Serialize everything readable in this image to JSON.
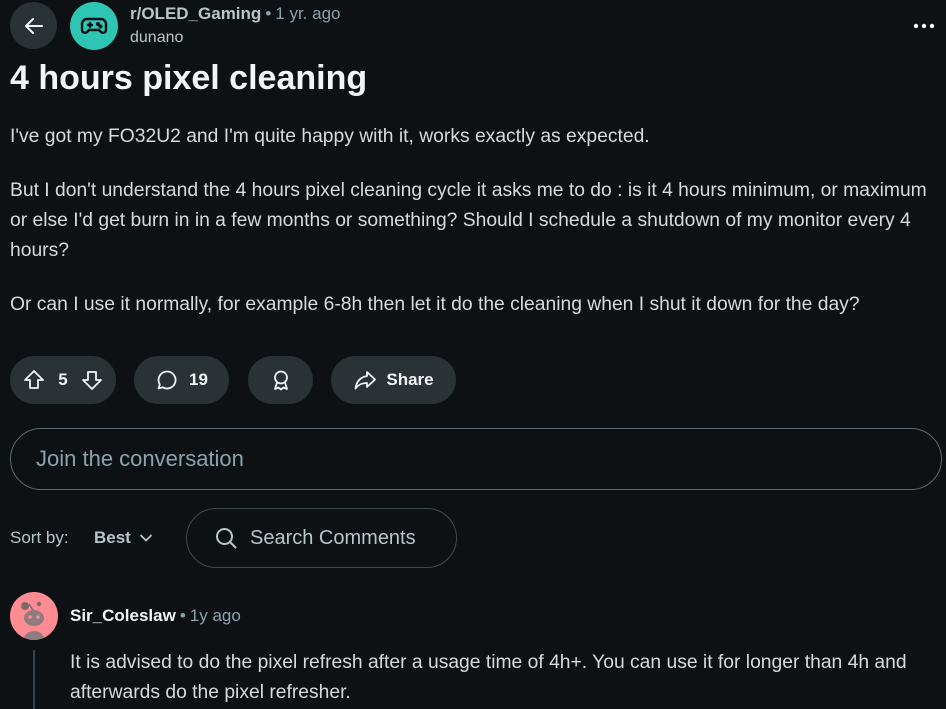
{
  "header": {
    "back_icon": "arrow-left-icon",
    "subreddit": "r/OLED_Gaming",
    "separator": "•",
    "age": "1 yr. ago",
    "author": "dunano",
    "subreddit_icon": "gamepad-icon",
    "subreddit_color": "#2ec5b4",
    "more_icon": "more-horizontal-icon"
  },
  "post": {
    "title": "4 hours pixel cleaning",
    "paragraphs": [
      "I've got my FO32U2 and I'm quite happy with it, works exactly as expected.",
      "But I don't understand the 4 hours pixel cleaning cycle it asks me to do : is it 4 hours minimum, or maximum or else I'd get burn in in a few months or something? Should I schedule a shutdown of my monitor every 4 hours?",
      "Or can I use it normally, for example 6-8h then let it do the cleaning when I shut it down for the day?"
    ]
  },
  "actions": {
    "vote_count": "5",
    "comment_count": "19",
    "share_label": "Share"
  },
  "comment_box": {
    "placeholder": "Join the conversation"
  },
  "sort": {
    "label": "Sort by:",
    "value": "Best",
    "search_placeholder": "Search Comments"
  },
  "comments": [
    {
      "user": "Sir_Coleslaw",
      "separator": "•",
      "age": "1y ago",
      "avatar_color": "#ff8b93",
      "text": "It is advised to do the pixel refresh after a usage time of 4h+. You can use it for longer than 4h and afterwards do the pixel refresher."
    }
  ]
}
